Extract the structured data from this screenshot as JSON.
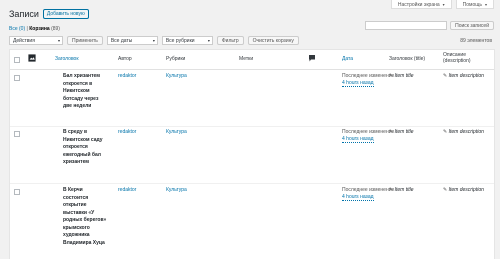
{
  "header": {
    "screen_options": "Настройки экрана",
    "help": "Помощь",
    "title": "Записи",
    "add_new": "Добавить новую"
  },
  "subsub": {
    "all": "Все (0)",
    "sep": "|",
    "trash": "Корзина",
    "trash_count": "(89)"
  },
  "search": {
    "placeholder": "",
    "button": "Поиск записей"
  },
  "toolbar": {
    "bulk_action": "Действия",
    "apply": "Применить",
    "dates": "Все даты",
    "categories": "Все рубрики",
    "filter": "Фильтр",
    "empty_trash": "Очистить корзину",
    "count": "89 элементов"
  },
  "columns": {
    "title": "Заголовок",
    "author": "Автор",
    "categories": "Рубрики",
    "tags": "Метки",
    "date": "Дата",
    "seo_title": "Заголовок (title)",
    "seo_desc_1": "Описание",
    "seo_desc_2": "(description)"
  },
  "rows": [
    {
      "title": "Бал хризантем откроется в Никитском ботсаду через две недели",
      "author": "redaktor",
      "category": "Культура",
      "date_status": "Последнее изменение",
      "date_ago": "4 hours назад",
      "yoast_title": "Item title",
      "yoast_desc": "Item description"
    },
    {
      "title": "В среду в Никитском саду откроется ежегодный бал хризантем",
      "author": "redaktor",
      "category": "Культура",
      "date_status": "Последнее изменение",
      "date_ago": "4 hours назад",
      "yoast_title": "Item title",
      "yoast_desc": "Item description"
    },
    {
      "title": "В Керчи состоится открытие выставки «У родных берегов» крымского художника Владимира Хуца",
      "author": "redaktor",
      "category": "Культура",
      "date_status": "Последнее изменение",
      "date_ago": "4 hours назад",
      "yoast_title": "Item title",
      "yoast_desc": "Item description"
    }
  ]
}
